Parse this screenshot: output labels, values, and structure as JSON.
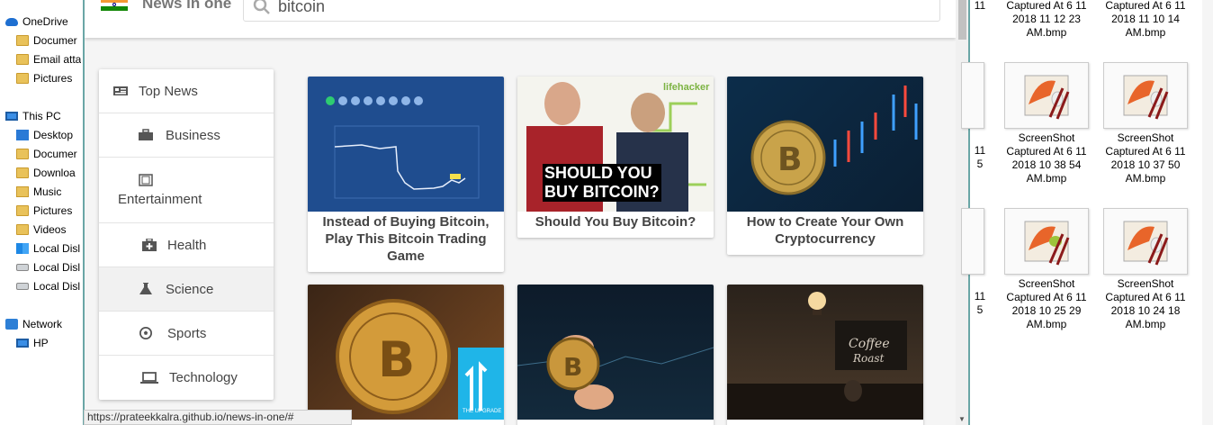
{
  "explorer": {
    "items": [
      {
        "label": "OneDrive",
        "icon": "onedrive-icon"
      },
      {
        "label": "Documer",
        "icon": "folder-icon"
      },
      {
        "label": "Email atta",
        "icon": "folder-icon"
      },
      {
        "label": "Pictures",
        "icon": "folder-icon"
      },
      {
        "label": "This PC",
        "icon": "computer-icon"
      },
      {
        "label": "Desktop",
        "icon": "desktop-folder-icon"
      },
      {
        "label": "Documer",
        "icon": "documents-folder-icon"
      },
      {
        "label": "Downloa",
        "icon": "downloads-folder-icon"
      },
      {
        "label": "Music",
        "icon": "music-folder-icon"
      },
      {
        "label": "Pictures",
        "icon": "pictures-folder-icon"
      },
      {
        "label": "Videos",
        "icon": "videos-folder-icon"
      },
      {
        "label": "Local Disl",
        "icon": "windows-drive-icon"
      },
      {
        "label": "Local Disl",
        "icon": "disk-drive-icon"
      },
      {
        "label": "Local Disl",
        "icon": "disk-drive-icon"
      },
      {
        "label": "Network",
        "icon": "network-icon"
      },
      {
        "label": "HP",
        "icon": "network-computer-icon"
      }
    ]
  },
  "app": {
    "brand": "News in one",
    "search_value": "bitcoin",
    "menu": [
      {
        "label": "Top News",
        "icon": "newspaper-icon"
      },
      {
        "label": "Business",
        "icon": "briefcase-icon"
      },
      {
        "label": "Entertainment",
        "icon": "film-icon"
      },
      {
        "label": "Health",
        "icon": "medkit-icon"
      },
      {
        "label": "Science",
        "icon": "flask-icon"
      },
      {
        "label": "Sports",
        "icon": "soccer-ball-icon"
      },
      {
        "label": "Technology",
        "icon": "laptop-icon"
      }
    ],
    "active_menu": "Science",
    "cards": [
      {
        "title": "Instead of Buying Bitcoin, Play This Bitcoin Trading Game",
        "image": "bitcoin-trading-game-screenshot"
      },
      {
        "title": "Should You Buy Bitcoin?",
        "image": "should-you-buy-bitcoin-thumbnail",
        "overlay_text_1": "SHOULD YOU",
        "overlay_text_2": "BUY BITCOIN?",
        "logo_text": "lifehacker"
      },
      {
        "title": "How to Create Your Own Cryptocurrency",
        "image": "bitcoin-coin-chart-photo"
      },
      {
        "title": "",
        "image": "bitcoin-coins-upgrade-photo",
        "logo_text": "THE UPGRADE"
      },
      {
        "title": "",
        "image": "hand-holding-bitcoin-photo"
      },
      {
        "title": "",
        "image": "coffee-shop-photo"
      }
    ]
  },
  "files": {
    "top_partial": [
      {
        "lines": [
          "11",
          "",
          ""
        ]
      },
      {
        "lines": [
          "Captured At 6 11",
          "2018 11 12 23",
          "AM.bmp"
        ]
      },
      {
        "lines": [
          "Captured At 6 11",
          "2018 11 10 14",
          "AM.bmp"
        ]
      }
    ],
    "row1": [
      {
        "lines": [
          "11",
          "5",
          ""
        ]
      },
      {
        "lines": [
          "ScreenShot",
          "Captured At 6 11",
          "2018 10 38 54",
          "AM.bmp"
        ]
      },
      {
        "lines": [
          "ScreenShot",
          "Captured At 6 11",
          "2018 10 37 50",
          "AM.bmp"
        ]
      }
    ],
    "row2": [
      {
        "lines": [
          "11",
          "5",
          ""
        ]
      },
      {
        "lines": [
          "ScreenShot",
          "Captured At 6 11",
          "2018 10 25 29",
          "AM.bmp"
        ]
      },
      {
        "lines": [
          "ScreenShot",
          "Captured At 6 11",
          "2018 10 24 18",
          "AM.bmp"
        ]
      }
    ]
  },
  "status": {
    "url": "https://prateekkalra.github.io/news-in-one/#"
  },
  "colors": {
    "accent": "#6aa6a6",
    "menu_text": "#444444",
    "card_title": "#444444",
    "flag_saffron": "#f49933",
    "flag_green": "#138808"
  }
}
